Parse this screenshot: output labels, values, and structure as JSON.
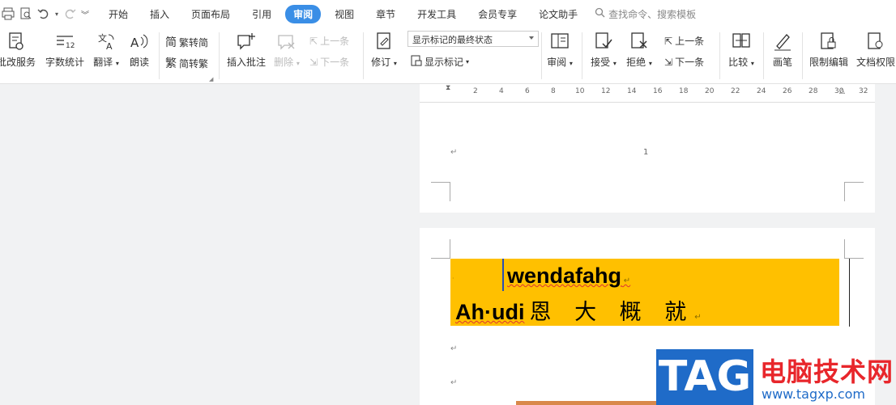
{
  "quick_access": {
    "print": "print",
    "preview": "print-preview",
    "undo": "undo",
    "redo": "redo",
    "more": "more"
  },
  "menu": {
    "tabs": [
      "开始",
      "插入",
      "页面布局",
      "引用",
      "审阅",
      "视图",
      "章节",
      "开发工具",
      "会员专享",
      "论文助手"
    ],
    "active_tab": "审阅",
    "search_placeholder": "查找命令、搜索模板"
  },
  "ribbon": {
    "correction": "批改服务",
    "word_count": "字数统计",
    "translate": "翻译",
    "read_aloud": "朗读",
    "trad_to_simp": "繁转简",
    "simp_to_trad": "简转繁",
    "insert_comment": "插入批注",
    "delete": "删除",
    "prev_comment": "上一条",
    "next_comment": "下一条",
    "track_changes": "修订",
    "display_mode": "显示标记的最终状态",
    "show_markup": "显示标记",
    "review": "审阅",
    "accept": "接受",
    "reject": "拒绝",
    "prev_change": "上一条",
    "next_change": "下一条",
    "compare": "比较",
    "ink": "画笔",
    "restrict_edit": "限制编辑",
    "doc_permission": "文档权限"
  },
  "ruler": {
    "marks": [
      "2",
      "4",
      "6",
      "8",
      "10",
      "12",
      "14",
      "16",
      "18",
      "20",
      "22",
      "24",
      "26",
      "28",
      "30",
      "32"
    ]
  },
  "document": {
    "page_number": "1",
    "line1": "wendafahg",
    "line2_latin": "Ah·udi",
    "line2_cjk": "恩 大 概 就"
  },
  "watermark": {
    "logo": "TAG",
    "name": "电脑技术网",
    "url": "www.tagxp.com"
  },
  "colors": {
    "accent": "#3a8ee6",
    "highlight": "#ffc000",
    "watermark_blue": "#1f6bc8",
    "watermark_red": "#e8262b"
  }
}
